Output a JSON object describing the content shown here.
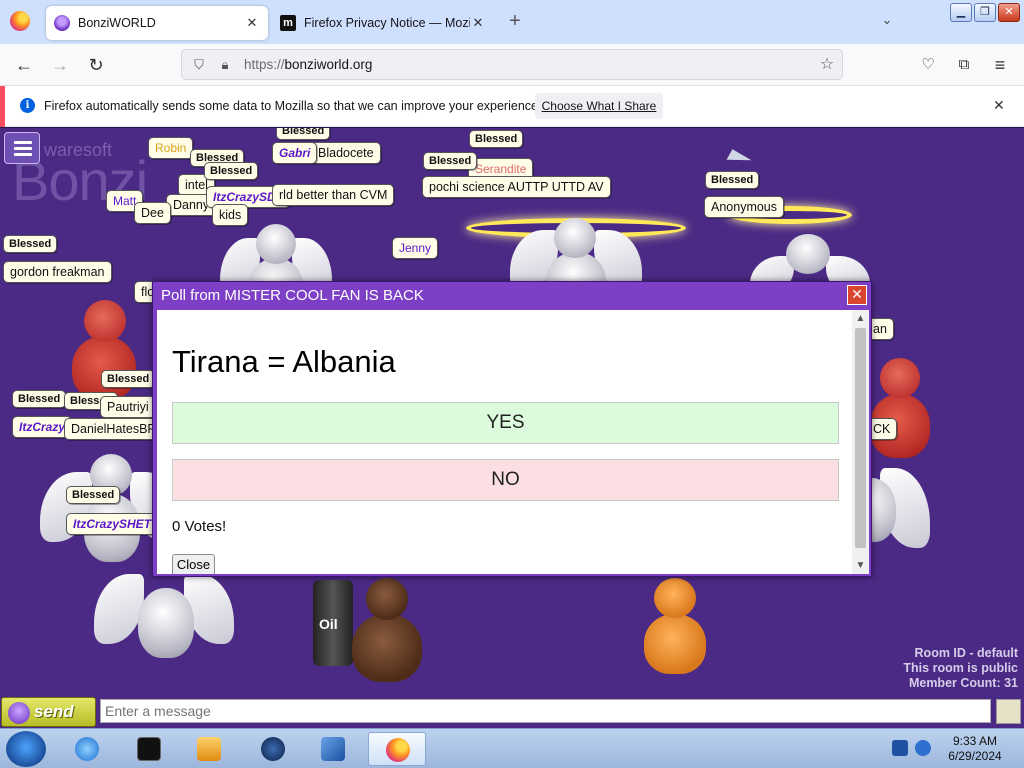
{
  "browser": {
    "tabs": [
      {
        "title": "BonziWORLD",
        "active": true,
        "favicon": "bonzi-favicon"
      },
      {
        "title": "Firefox Privacy Notice — Mozilla",
        "active": false,
        "favicon": "mozilla-favicon"
      }
    ],
    "new_tab": "+",
    "url_protocol": "https://",
    "url_host": "bonziworld.org",
    "notification": {
      "message": "Firefox automatically sends some data to Mozilla so that we can improve your experience.",
      "action_label": "Choose What I Share",
      "info_glyph": "i"
    }
  },
  "app": {
    "logo_small": "waresoft",
    "logo_big": "Bonzi",
    "room_id": "Room ID - default",
    "room_public": "This room is public",
    "member_count": "Member Count: 31",
    "barrel_text": "Oil"
  },
  "bubbles": [
    {
      "text": "Blessed",
      "style": "b"
    },
    {
      "text": "Bladocete",
      "style": "name"
    },
    {
      "text": "Robin",
      "style": "gold"
    },
    {
      "text": "Blessed",
      "style": "b"
    },
    {
      "text": "intel",
      "style": "name"
    },
    {
      "text": "Danny",
      "style": "name"
    },
    {
      "text": "Blessed",
      "style": "b"
    },
    {
      "text": "Gabri",
      "style": "ital"
    },
    {
      "text": "Blessed",
      "style": "b"
    },
    {
      "text": "Serandite",
      "style": "pink"
    },
    {
      "text": "pochi science AUTTP UTTD AV",
      "style": "name"
    },
    {
      "text": "Blessed",
      "style": "b"
    },
    {
      "text": "Anonymous",
      "style": "name"
    },
    {
      "text": "ItzCrazySDF",
      "style": "ital"
    },
    {
      "text": "rld better than CVM",
      "style": "name"
    },
    {
      "text": "Matt",
      "style": "purple"
    },
    {
      "text": "Dee",
      "style": "name"
    },
    {
      "text": "kids",
      "style": "name"
    },
    {
      "text": "Blessed",
      "style": "b"
    },
    {
      "text": "gordon freakman",
      "style": "name"
    },
    {
      "text": "Jenny",
      "style": "purple"
    },
    {
      "text": "flo",
      "style": "name"
    },
    {
      "text": "an",
      "style": "name"
    },
    {
      "text": "Blessed",
      "style": "b"
    },
    {
      "text": "Blessed",
      "style": "b"
    },
    {
      "text": "Blessed",
      "style": "b"
    },
    {
      "text": "Pautriyi",
      "style": "name"
    },
    {
      "text": "ItzCrazy",
      "style": "ital"
    },
    {
      "text": "DanielHatesBFD",
      "style": "name"
    },
    {
      "text": "CK",
      "style": "name"
    },
    {
      "text": "Blessed",
      "style": "b"
    },
    {
      "text": "ItzCrazySHET",
      "style": "ital"
    }
  ],
  "poll": {
    "header": "Poll from MISTER COOL FAN IS BACK",
    "close_glyph": "✕",
    "question": "Tirana = Albania",
    "yes_label": "YES",
    "no_label": "NO",
    "votes": "0 Votes!",
    "close_label": "Close"
  },
  "chat": {
    "send_label": "send",
    "placeholder": "Enter a message"
  },
  "taskbar": {
    "time": "9:33 AM",
    "date": "6/29/2024",
    "apps": [
      "start-orb",
      "internet-explorer",
      "command-prompt",
      "media-player",
      "globe-app",
      "virtualbox",
      "firefox"
    ]
  },
  "colors": {
    "page_bg": "#4b2a85",
    "poll_header": "#7c3fc6",
    "yes_bg": "#dcfbdc",
    "no_bg": "#fbdfe2",
    "send_button": "#c9cf3a"
  }
}
